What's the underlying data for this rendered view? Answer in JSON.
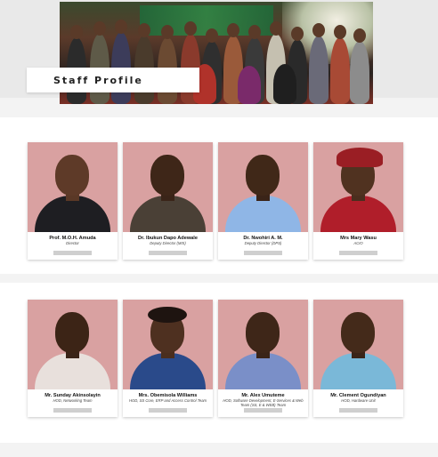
{
  "header": {
    "title": "Staff Profile"
  },
  "staff": [
    {
      "name": "Prof. M.O.H. Amuda",
      "role": "Director"
    },
    {
      "name": "Dr. Ibukun Dapo Adewale",
      "role": "Deputy Director (MIS)"
    },
    {
      "name": "Dr. Nwohiri A. M.",
      "role": "Deputy Director (DPS)"
    },
    {
      "name": "Mrs Mary Wasu",
      "role": "ACIO"
    },
    {
      "name": "Mr. Sunday Akinsolayin",
      "role": "HOD, Networking Team"
    },
    {
      "name": "Mrs. Obemisola Williams",
      "role": "HOD, SS Core, ERP and Access Control Team"
    },
    {
      "name": "Mr. Alex Umuteme",
      "role": "HOD, Software Development, E-Services & Web Team (SS, E & WEB) Team"
    },
    {
      "name": "Mr. Clement Ogundiyan",
      "role": "HOD, Hardware Unit"
    }
  ],
  "colors": {
    "photo_background": "#d9a1a1",
    "page_background": "#f3f3f3"
  }
}
